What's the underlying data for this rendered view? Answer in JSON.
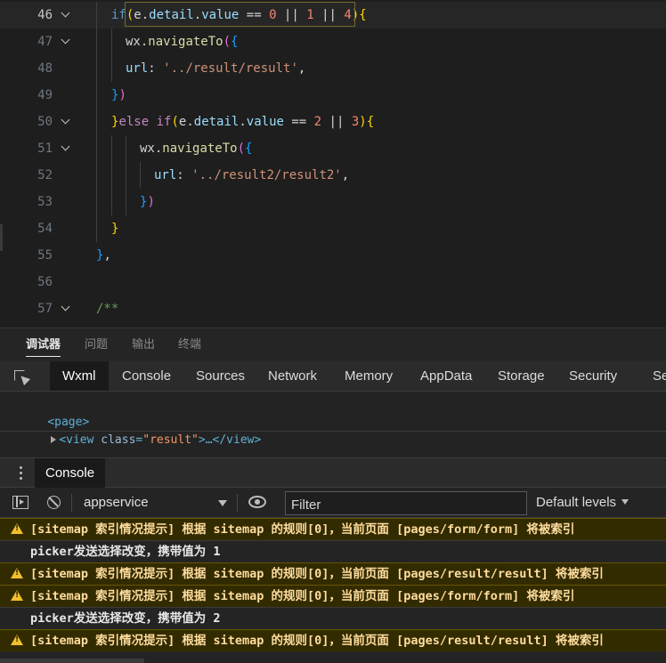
{
  "editor": {
    "lines": [
      {
        "no": "46",
        "fold": true,
        "active": true,
        "tokens": [
          [
            "t-kw",
            "if"
          ],
          [
            "t-b1",
            "("
          ],
          [
            "t-id",
            "e"
          ],
          [
            "t-op",
            "."
          ],
          [
            "t-prop",
            "detail"
          ],
          [
            "t-op",
            "."
          ],
          [
            "t-prop",
            "value"
          ],
          [
            "t-op",
            " == "
          ],
          [
            "t-num",
            "0"
          ],
          [
            "t-op",
            " || "
          ],
          [
            "t-num",
            "1"
          ],
          [
            "t-op",
            " || "
          ],
          [
            "t-num",
            "4"
          ],
          [
            "t-b1",
            ")"
          ],
          [
            "t-b1",
            "{"
          ]
        ]
      },
      {
        "no": "47",
        "fold": true,
        "active": false,
        "tokens": [
          [
            "t-id",
            "wx"
          ],
          [
            "t-op",
            "."
          ],
          [
            "t-fn",
            "navigateTo"
          ],
          [
            "t-b2",
            "("
          ],
          [
            "t-b3",
            "{"
          ]
        ]
      },
      {
        "no": "48",
        "fold": false,
        "active": false,
        "tokens": [
          [
            "t-prop",
            "url"
          ],
          [
            "t-op",
            ": "
          ],
          [
            "t-str",
            "'../result/result'"
          ],
          [
            "t-op",
            ","
          ]
        ]
      },
      {
        "no": "49",
        "fold": false,
        "active": false,
        "tokens": [
          [
            "t-b3",
            "}"
          ],
          [
            "t-b2",
            ")"
          ]
        ]
      },
      {
        "no": "50",
        "fold": true,
        "active": false,
        "tokens": [
          [
            "t-b1",
            "}"
          ],
          [
            "t-kw2",
            "else"
          ],
          [
            "t-op",
            " "
          ],
          [
            "t-kw2",
            "if"
          ],
          [
            "t-b1",
            "("
          ],
          [
            "t-id",
            "e"
          ],
          [
            "t-op",
            "."
          ],
          [
            "t-prop",
            "detail"
          ],
          [
            "t-op",
            "."
          ],
          [
            "t-prop",
            "value"
          ],
          [
            "t-op",
            " == "
          ],
          [
            "t-num",
            "2"
          ],
          [
            "t-op",
            " || "
          ],
          [
            "t-num",
            "3"
          ],
          [
            "t-b1",
            ")"
          ],
          [
            "t-b1",
            "{"
          ]
        ]
      },
      {
        "no": "51",
        "fold": true,
        "active": false,
        "tokens": [
          [
            "t-id",
            "wx"
          ],
          [
            "t-op",
            "."
          ],
          [
            "t-fn",
            "navigateTo"
          ],
          [
            "t-b2",
            "("
          ],
          [
            "t-b3",
            "{"
          ]
        ]
      },
      {
        "no": "52",
        "fold": false,
        "active": false,
        "tokens": [
          [
            "t-prop",
            "url"
          ],
          [
            "t-op",
            ": "
          ],
          [
            "t-str",
            "'../result2/result2'"
          ],
          [
            "t-op",
            ","
          ]
        ]
      },
      {
        "no": "53",
        "fold": false,
        "active": false,
        "tokens": [
          [
            "t-b3",
            "}"
          ],
          [
            "t-b2",
            ")"
          ]
        ]
      },
      {
        "no": "54",
        "fold": false,
        "active": false,
        "tokens": [
          [
            "t-b1",
            "}"
          ]
        ]
      },
      {
        "no": "55",
        "fold": false,
        "active": false,
        "tokens": [
          [
            "t-b3",
            "}"
          ],
          [
            "t-op",
            ","
          ]
        ]
      },
      {
        "no": "56",
        "fold": false,
        "active": false,
        "tokens": []
      },
      {
        "no": "57",
        "fold": true,
        "active": false,
        "tokens": [
          [
            "t-cm",
            "/**"
          ]
        ]
      }
    ]
  },
  "panel_tabs": [
    "调试器",
    "问题",
    "输出",
    "终端"
  ],
  "devtools_tabs": [
    "Wxml",
    "Console",
    "Sources",
    "Network",
    "Memory",
    "AppData",
    "Storage",
    "Security",
    "Se"
  ],
  "dom": {
    "open_tag": "<page>",
    "child_tag_open": "<view",
    "child_attr": "class",
    "child_attr_val": "\"result\"",
    "child_rest": ">…</view>"
  },
  "drawer": {
    "tab": "Console"
  },
  "console_toolbar": {
    "context": "appservice",
    "filter_placeholder": "Filter",
    "levels": "Default levels"
  },
  "messages": [
    {
      "type": "warn",
      "text": "[sitemap 索引情况提示] 根据 sitemap 的规则[0]，当前页面 [pages/form/form] 将被索引"
    },
    {
      "type": "log",
      "text": "picker发送选择改变，携带值为 1"
    },
    {
      "type": "warn",
      "text": "[sitemap 索引情况提示] 根据 sitemap 的规则[0]，当前页面 [pages/result/result] 将被索引"
    },
    {
      "type": "warn",
      "text": "[sitemap 索引情况提示] 根据 sitemap 的规则[0]，当前页面 [pages/form/form] 将被索引"
    },
    {
      "type": "log",
      "text": "picker发送选择改变，携带值为 2"
    },
    {
      "type": "warn",
      "text": "[sitemap 索引情况提示] 根据 sitemap 的规则[0]，当前页面 [pages/result/result] 将被索引"
    }
  ],
  "colors": {
    "editor_bg": "#1e1e1e",
    "warn_bg": "#332b00",
    "warn_text": "#ffdd9e",
    "warn_icon": "#f2c02d"
  }
}
